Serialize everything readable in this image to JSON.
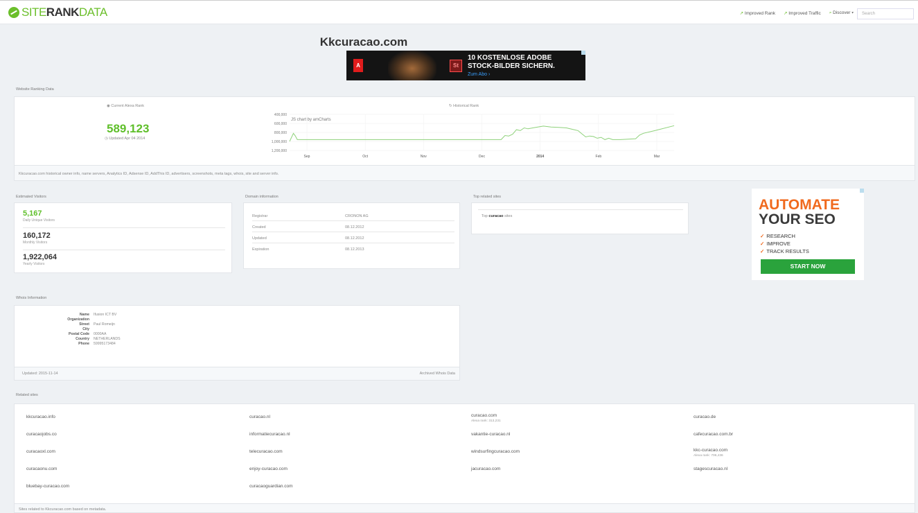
{
  "header": {
    "logo": {
      "site": "SITE",
      "rank": "RANK",
      "data": "DATA"
    },
    "nav": [
      {
        "icon": "trend-up-icon",
        "label": "Improved Rank"
      },
      {
        "icon": "trend-up-icon",
        "label": "Improved Traffic"
      },
      {
        "icon": "search-icon",
        "label": "Discover"
      }
    ],
    "search_placeholder": "Search"
  },
  "page_title": "Kkcuracao.com",
  "banner_ad": {
    "adobe_mark": "A",
    "product_mark": "St",
    "headline_line1": "10 KOSTENLOSE ADOBE",
    "headline_line2": "STOCK-BILDER SICHERN.",
    "cta": "Zum Abo ›"
  },
  "ranking": {
    "section_label": "Website Ranking Data",
    "current_label": "Current Alexa Rank",
    "rank": "589,123",
    "updated": "Updated Apr 04 2014",
    "historical_label": "Historical Rank",
    "footnote": "Kkcuracao.com historical owner info, name servers, Analytics ID, Adsense ID, AddThis ID, advertisers, screenshots, meta tags, whois, site and server info."
  },
  "chart_data": {
    "type": "line",
    "annotation": "JS chart by amCharts",
    "y_ticks": [
      "400,000",
      "600,000",
      "800,000",
      "1,000,000",
      "1,200,000"
    ],
    "x_ticks": [
      "Sep",
      "Oct",
      "Nov",
      "Dec",
      "2014",
      "Feb",
      "Mar"
    ],
    "y_reversed": true,
    "ylim": [
      400000,
      1200000
    ],
    "series": [
      {
        "color": "#8ed17a",
        "x": [
          0,
          0.01,
          0.015,
          0.02,
          0.2,
          0.5,
          0.55,
          0.56,
          0.57,
          0.58,
          0.59,
          0.6,
          0.61,
          0.62,
          0.64,
          0.66,
          0.68,
          0.7,
          0.72,
          0.74,
          0.75,
          0.76,
          0.77,
          0.78,
          0.79,
          0.8,
          0.81,
          0.82,
          0.83,
          0.84,
          0.85,
          0.86,
          0.9,
          0.91,
          0.92,
          0.95,
          1.0
        ],
        "values": [
          1000000,
          820000,
          880000,
          960000,
          960000,
          960000,
          960000,
          870000,
          880000,
          840000,
          740000,
          760000,
          700000,
          720000,
          690000,
          660000,
          680000,
          690000,
          700000,
          740000,
          760000,
          830000,
          900000,
          880000,
          890000,
          930000,
          910000,
          960000,
          930000,
          960000,
          960000,
          960000,
          940000,
          860000,
          820000,
          760000,
          650000
        ]
      }
    ]
  },
  "visitors": {
    "section_label": "Estimated Visitors",
    "items": [
      {
        "value": "5,167",
        "label": "Daily Unique Visitors"
      },
      {
        "value": "160,172",
        "label": "Monthly Visitors"
      },
      {
        "value": "1,922,064",
        "label": "Yearly Visitors"
      }
    ]
  },
  "domain": {
    "section_label": "Domain information",
    "rows": [
      {
        "key": "Registrar",
        "value": "CRONON AG"
      },
      {
        "key": "Created",
        "value": "08.12.2012"
      },
      {
        "key": "Updated",
        "value": "08.12.2012"
      },
      {
        "key": "Expiration",
        "value": "08.12.2013"
      }
    ]
  },
  "top_related": {
    "section_label": "Top related sites",
    "prefix": "Top",
    "keyword": "curacao",
    "suffix": "sites"
  },
  "seo_ad": {
    "line1": "AUTOMATE",
    "line2": "YOUR SEO",
    "items": [
      "RESEARCH",
      "IMPROVE",
      "TRACK RESULTS"
    ],
    "button": "START NOW"
  },
  "whois": {
    "section_label": "Whois Information",
    "rows": [
      {
        "key": "Name",
        "value": "Ifusion ICT BV"
      },
      {
        "key": "Organization",
        "value": ""
      },
      {
        "key": "Street",
        "value": "Paul Romeijn"
      },
      {
        "key": "City",
        "value": ""
      },
      {
        "key": "Postal Code",
        "value": "0000AA"
      },
      {
        "key": "Country",
        "value": "NETHERLANDS"
      },
      {
        "key": "Phone",
        "value": "59995173484"
      }
    ],
    "updated": "Updated: 2015-11-14",
    "archived_link": "Archived Whois Data"
  },
  "related": {
    "section_label": "Related sites",
    "columns": [
      [
        {
          "name": "kkcuracao.info"
        },
        {
          "name": "curacaojobs.co"
        },
        {
          "name": "curacaoxl.com"
        },
        {
          "name": "curacaonu.com"
        },
        {
          "name": "bluebay-curacao.com"
        }
      ],
      [
        {
          "name": "curacao.nl"
        },
        {
          "name": "informatiecuracao.nl"
        },
        {
          "name": "telecuracao.com"
        },
        {
          "name": "enjoy-curacao.com"
        },
        {
          "name": "curacaoguardian.com"
        }
      ],
      [
        {
          "name": "curacao.com",
          "meta": "Alexa rank: 313,231"
        },
        {
          "name": "vakantie-curacao.nl"
        },
        {
          "name": "windsurfingcuracao.com"
        },
        {
          "name": "jacuracao.com"
        }
      ],
      [
        {
          "name": "curacao.de"
        },
        {
          "name": "cafecuracao.com.br"
        },
        {
          "name": "kkc-curacao.com",
          "meta": "Alexa rank: 706,436"
        },
        {
          "name": "stagescuracao.nl"
        }
      ]
    ],
    "footnote": "Sites related to Kkcuracao.com based on metadata."
  }
}
